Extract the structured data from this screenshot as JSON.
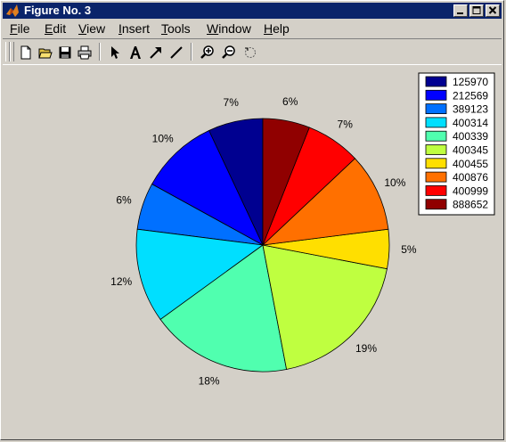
{
  "window": {
    "title": "Figure No. 3",
    "controls": [
      "minimize-icon",
      "maximize-icon",
      "close-icon"
    ]
  },
  "menu": [
    {
      "label": "File",
      "accel": "F"
    },
    {
      "label": "Edit",
      "accel": "E"
    },
    {
      "label": "View",
      "accel": "V"
    },
    {
      "label": "Insert",
      "accel": "I"
    },
    {
      "label": "Tools",
      "accel": "T"
    },
    {
      "label": "Window",
      "accel": "W"
    },
    {
      "label": "Help",
      "accel": "H"
    }
  ],
  "toolbar": {
    "buttons": [
      "new-file-icon",
      "open-folder-icon",
      "save-icon",
      "print-icon",
      "select-arrow-icon",
      "insert-text-icon",
      "insert-arrow-icon",
      "insert-line-icon",
      "zoom-in-icon",
      "zoom-out-icon",
      "rotate-icon"
    ]
  },
  "chart_data": {
    "type": "pie",
    "title": "",
    "slices": [
      {
        "label": "125970",
        "value": 7,
        "percent_label": "7%",
        "color": "#000090"
      },
      {
        "label": "212569",
        "value": 10,
        "percent_label": "10%",
        "color": "#0000ff"
      },
      {
        "label": "389123",
        "value": 6,
        "percent_label": "6%",
        "color": "#0070ff"
      },
      {
        "label": "400314",
        "value": 12,
        "percent_label": "12%",
        "color": "#00dfff"
      },
      {
        "label": "400339",
        "value": 18,
        "percent_label": "18%",
        "color": "#50ffaf"
      },
      {
        "label": "400345",
        "value": 19,
        "percent_label": "19%",
        "color": "#bfff40"
      },
      {
        "label": "400455",
        "value": 5,
        "percent_label": "5%",
        "color": "#ffdf00"
      },
      {
        "label": "400876",
        "value": 10,
        "percent_label": "10%",
        "color": "#ff7000"
      },
      {
        "label": "400999",
        "value": 7,
        "percent_label": "7%",
        "color": "#ff0000"
      },
      {
        "label": "888652",
        "value": 6,
        "percent_label": "6%",
        "color": "#900000"
      }
    ],
    "direction": "counterclockwise",
    "start": "top",
    "legend": {
      "position": "top-right"
    }
  }
}
